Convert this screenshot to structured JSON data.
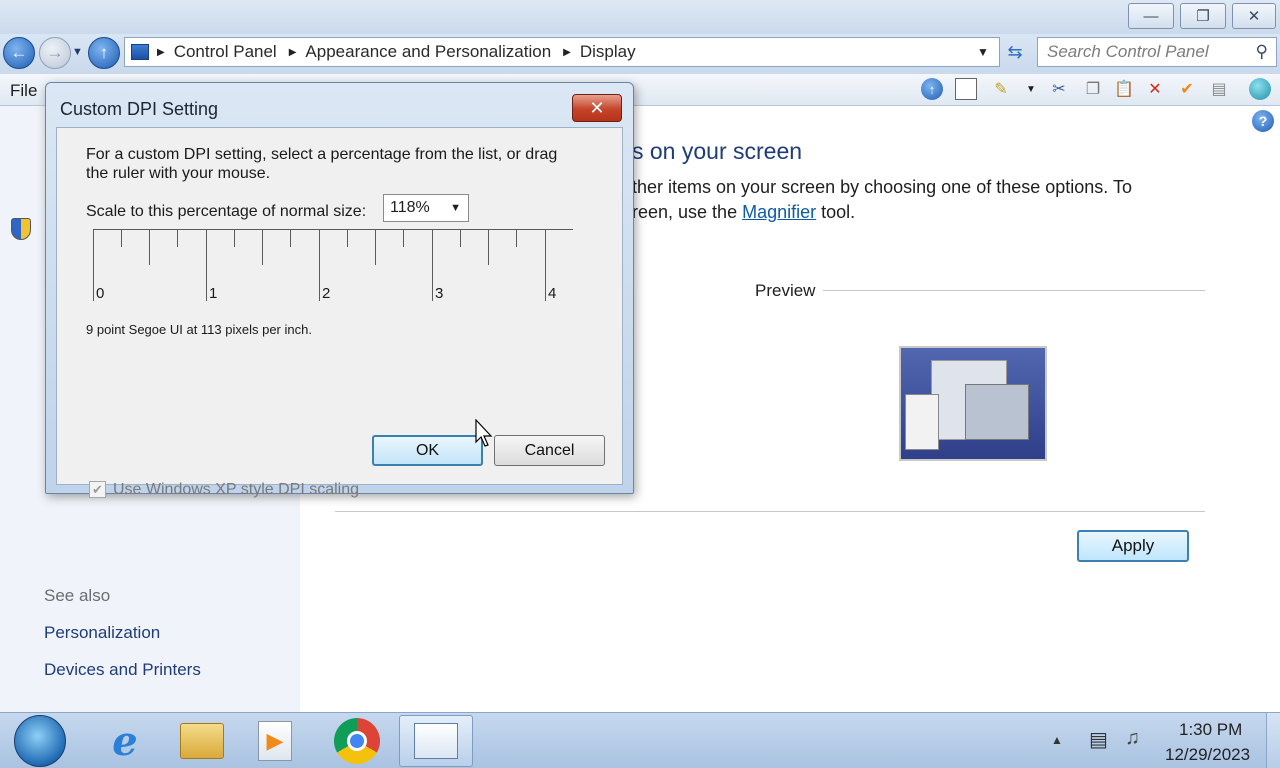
{
  "window": {
    "caption_buttons": [
      "minimize-icon",
      "restore-icon",
      "close-icon"
    ]
  },
  "address": {
    "breadcrumbs": [
      "Control Panel",
      "Appearance and Personalization",
      "Display"
    ],
    "search_placeholder": "Search Control Panel"
  },
  "menu": {
    "file_label": "File"
  },
  "page": {
    "heading_partial": "s on your screen",
    "desc_line1": "ther items on your screen by choosing one of these options. To",
    "desc_line2_a": "reen, use the ",
    "desc_link": "Magnifier",
    "desc_line2_b": " tool.",
    "preview_label": "Preview",
    "apply_label": "Apply"
  },
  "see_also": {
    "title": "See also",
    "items": [
      "Personalization",
      "Devices and Printers"
    ]
  },
  "dialog": {
    "title": "Custom DPI Setting",
    "instructions": "For a custom DPI setting, select a percentage from the list, or drag the ruler with your mouse.",
    "instructions_l1": "For a custom DPI setting, select a percentage from the list, or drag",
    "instructions_l2": "the ruler with your mouse.",
    "scale_label": "Scale to this percentage of normal size:",
    "scale_value": "118%",
    "ruler_labels": [
      "0",
      "1",
      "2",
      "3",
      "4"
    ],
    "sample_text": "9 point Segoe UI at 113 pixels per inch.",
    "xp_checkbox_label": "Use Windows XP style DPI scaling",
    "xp_checkbox_checked": true,
    "ok_label": "OK",
    "cancel_label": "Cancel"
  },
  "taskbar": {
    "apps": [
      "windows-start-icon",
      "internet-explorer-icon",
      "file-explorer-icon",
      "media-player-icon",
      "chrome-icon",
      "control-panel-icon"
    ],
    "time": "1:30 PM",
    "date": "12/29/2023"
  }
}
